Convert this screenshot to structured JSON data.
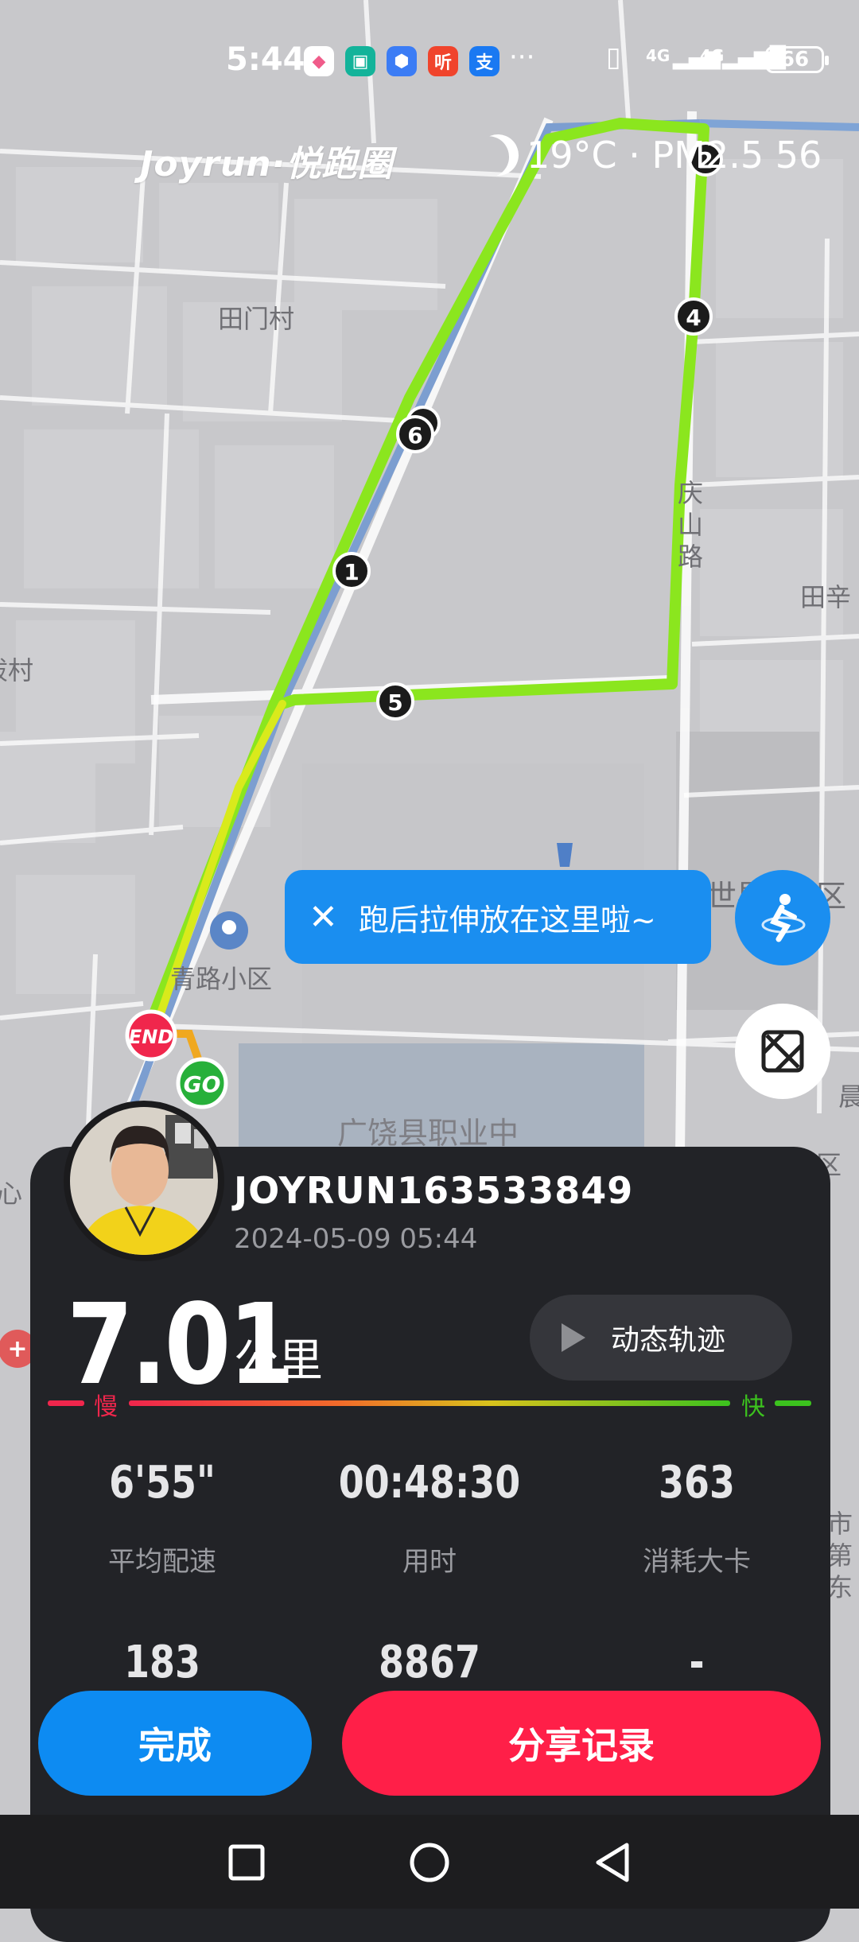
{
  "status_bar": {
    "time": "5:44",
    "app_icons": [
      {
        "name": "color-app-icon",
        "glyph": "◆",
        "color": "#ffffff"
      },
      {
        "name": "mi-icon",
        "glyph": "▣",
        "color": "#13b39a"
      },
      {
        "name": "shield-app-icon",
        "glyph": "⬢",
        "color": "#3b7cf5"
      },
      {
        "name": "listen-app-icon",
        "glyph": "听",
        "color": "#f0442c"
      },
      {
        "name": "alipay-icon",
        "glyph": "支",
        "color": "#1a79f2"
      }
    ],
    "more": "···",
    "signal1": "4G",
    "signal2": "4G",
    "battery": "66"
  },
  "header": {
    "brand": "Joyrun·悦跑圈",
    "weather": "19°C · PM2.5 56"
  },
  "map": {
    "labels": [
      {
        "text": "田门村"
      },
      {
        "text": "秡村"
      },
      {
        "text": "庆山路"
      },
      {
        "text": "田辛"
      },
      {
        "text": "青路小区"
      },
      {
        "text": "广饶县职业中"
      },
      {
        "text": "世界"
      },
      {
        "text": "区"
      },
      {
        "text": "晨"
      },
      {
        "text": "心"
      },
      {
        "text": "市第东"
      }
    ],
    "km_markers": [
      "1",
      "2",
      "4",
      "5",
      "6"
    ],
    "end_label": "END",
    "start_label": "GO",
    "route_color": "#8be61e"
  },
  "tooltip": {
    "close_glyph": "✕",
    "text": "跑后拉伸放在这里啦~"
  },
  "run": {
    "username": "JOYRUN163533849",
    "datetime": "2024-05-09 05:44",
    "distance": "7.01",
    "distance_unit": "公里",
    "dynamic_track_label": "动态轨迹",
    "speed_slow": "慢",
    "speed_fast": "快",
    "stats": [
      {
        "value": "6'55\"",
        "label": "平均配速"
      },
      {
        "value": "00:48:30",
        "label": "用时"
      },
      {
        "value": "363",
        "label": "消耗大卡"
      },
      {
        "value": "183",
        "label": ""
      },
      {
        "value": "8867",
        "label": ""
      },
      {
        "value": "-",
        "label": ""
      }
    ]
  },
  "actions": {
    "done": "完成",
    "share": "分享记录"
  },
  "colors": {
    "accent_blue": "#0d8bf2",
    "accent_red": "#ff1f48",
    "card_bg": "#222327"
  }
}
